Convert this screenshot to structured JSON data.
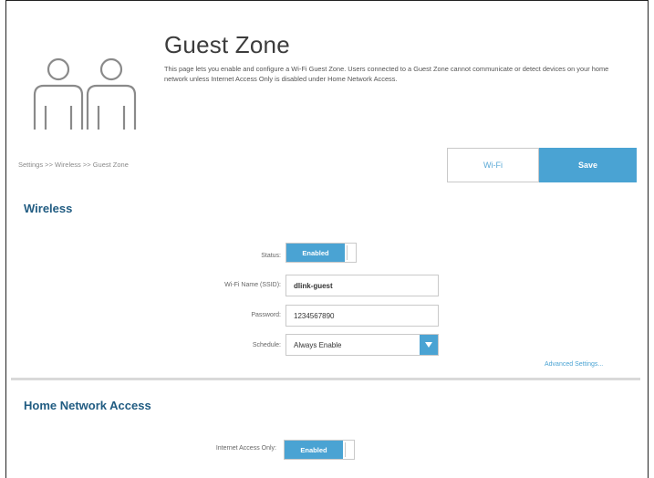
{
  "header": {
    "title": "Guest Zone",
    "description": "This page lets you enable and configure a Wi-Fi Guest Zone. Users connected to a Guest Zone cannot communicate or detect devices on your home network unless Internet Access Only is disabled under Home Network Access."
  },
  "breadcrumb": "Settings >> Wireless >> Guest Zone",
  "toolbar": {
    "wifi_label": "Wi-Fi",
    "save_label": "Save"
  },
  "wireless": {
    "title": "Wireless",
    "status_label": "Status:",
    "status_value": "Enabled",
    "ssid_label": "Wi-Fi Name (SSID):",
    "ssid_value": "dlink-guest",
    "password_label": "Password:",
    "password_value": "1234567890",
    "schedule_label": "Schedule:",
    "schedule_value": "Always Enable",
    "advanced_link": "Advanced Settings..."
  },
  "home_network": {
    "title": "Home Network Access",
    "internet_only_label": "Internet Access Only:",
    "internet_only_value": "Enabled"
  },
  "colors": {
    "accent": "#4aa3d3",
    "section_title": "#215c82"
  },
  "icons": {
    "hero": "two-users-icon",
    "select_arrow": "chevron-down-icon"
  }
}
